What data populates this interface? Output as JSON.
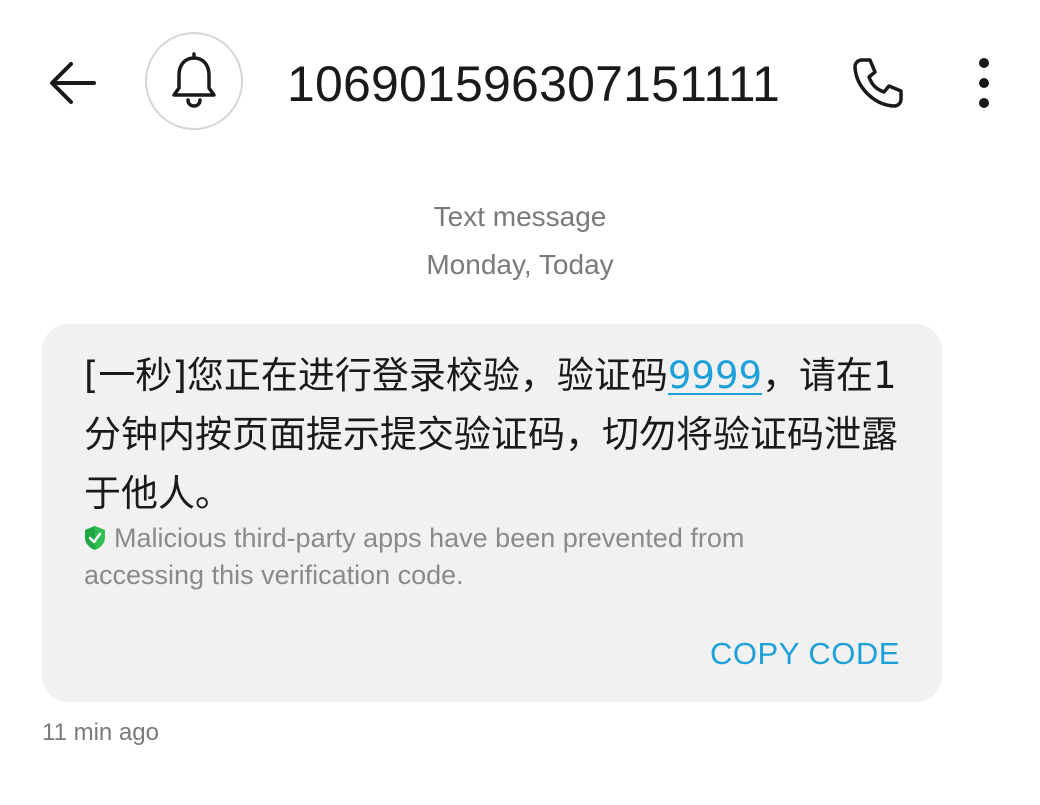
{
  "header": {
    "back_icon": "arrow-left-icon",
    "bell_icon": "bell-icon",
    "contact": "106901596307151111",
    "call_icon": "phone-icon",
    "more_icon": "more-vertical-icon"
  },
  "meta": {
    "type": "Text message",
    "date": "Monday, Today"
  },
  "message": {
    "text_before_code": "[一秒]您正在进行登录校验，验证码",
    "code": "9999",
    "text_after_code": "，请在1分钟内按页面提示提交验证码，切勿将验证码泄露于他人。",
    "security_icon": "shield-check-icon",
    "security_note": "Malicious third-party apps have been prevented from accessing this verification code.",
    "copy_button": "COPY CODE",
    "timestamp": "11 min ago"
  },
  "colors": {
    "accent": "#1ea0d8",
    "bubble": "#f1f1f1",
    "shield": "#2fbf52",
    "meta_text": "#7a7a7a"
  }
}
